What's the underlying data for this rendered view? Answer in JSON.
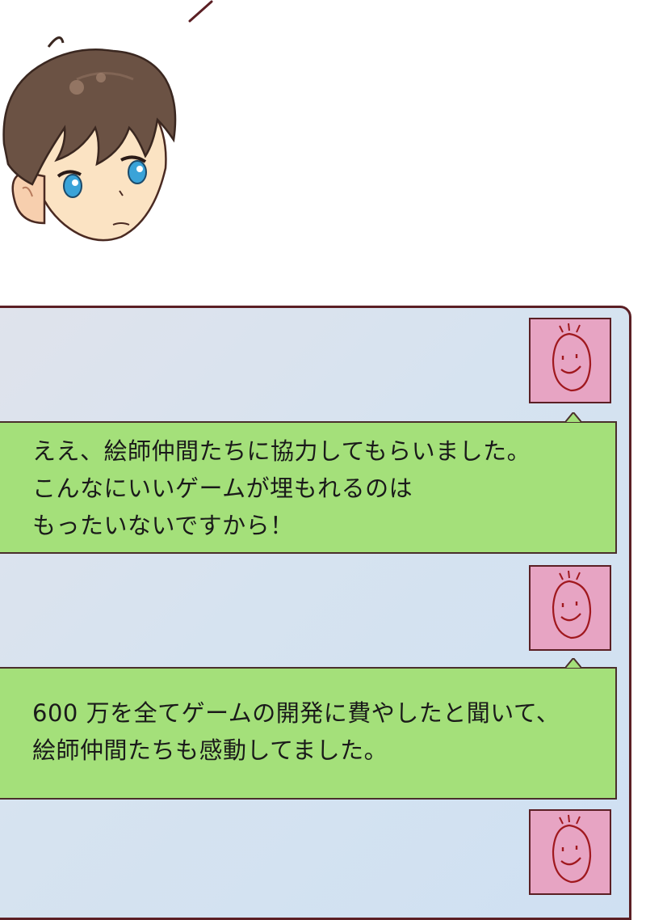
{
  "chat": {
    "messages": [
      {
        "avatar_icon": "smiley-doodle-icon",
        "lines": [
          "ええ、絵師仲間たちに協力してもらいました。",
          "こんなにいいゲームが埋もれるのは",
          "もったいないですから！"
        ]
      },
      {
        "avatar_icon": "smiley-doodle-icon",
        "lines": [
          "600 万を全てゲームの開発に費やしたと聞いて、",
          "絵師仲間たちも感動してました。"
        ]
      }
    ],
    "trailing_avatar_icon": "smiley-doodle-icon"
  },
  "colors": {
    "bubble": "#a4e07a",
    "avatar_bg": "#e7a4c3",
    "panel_border": "#5b1f24",
    "panel_bg": "#d6e3f0"
  }
}
